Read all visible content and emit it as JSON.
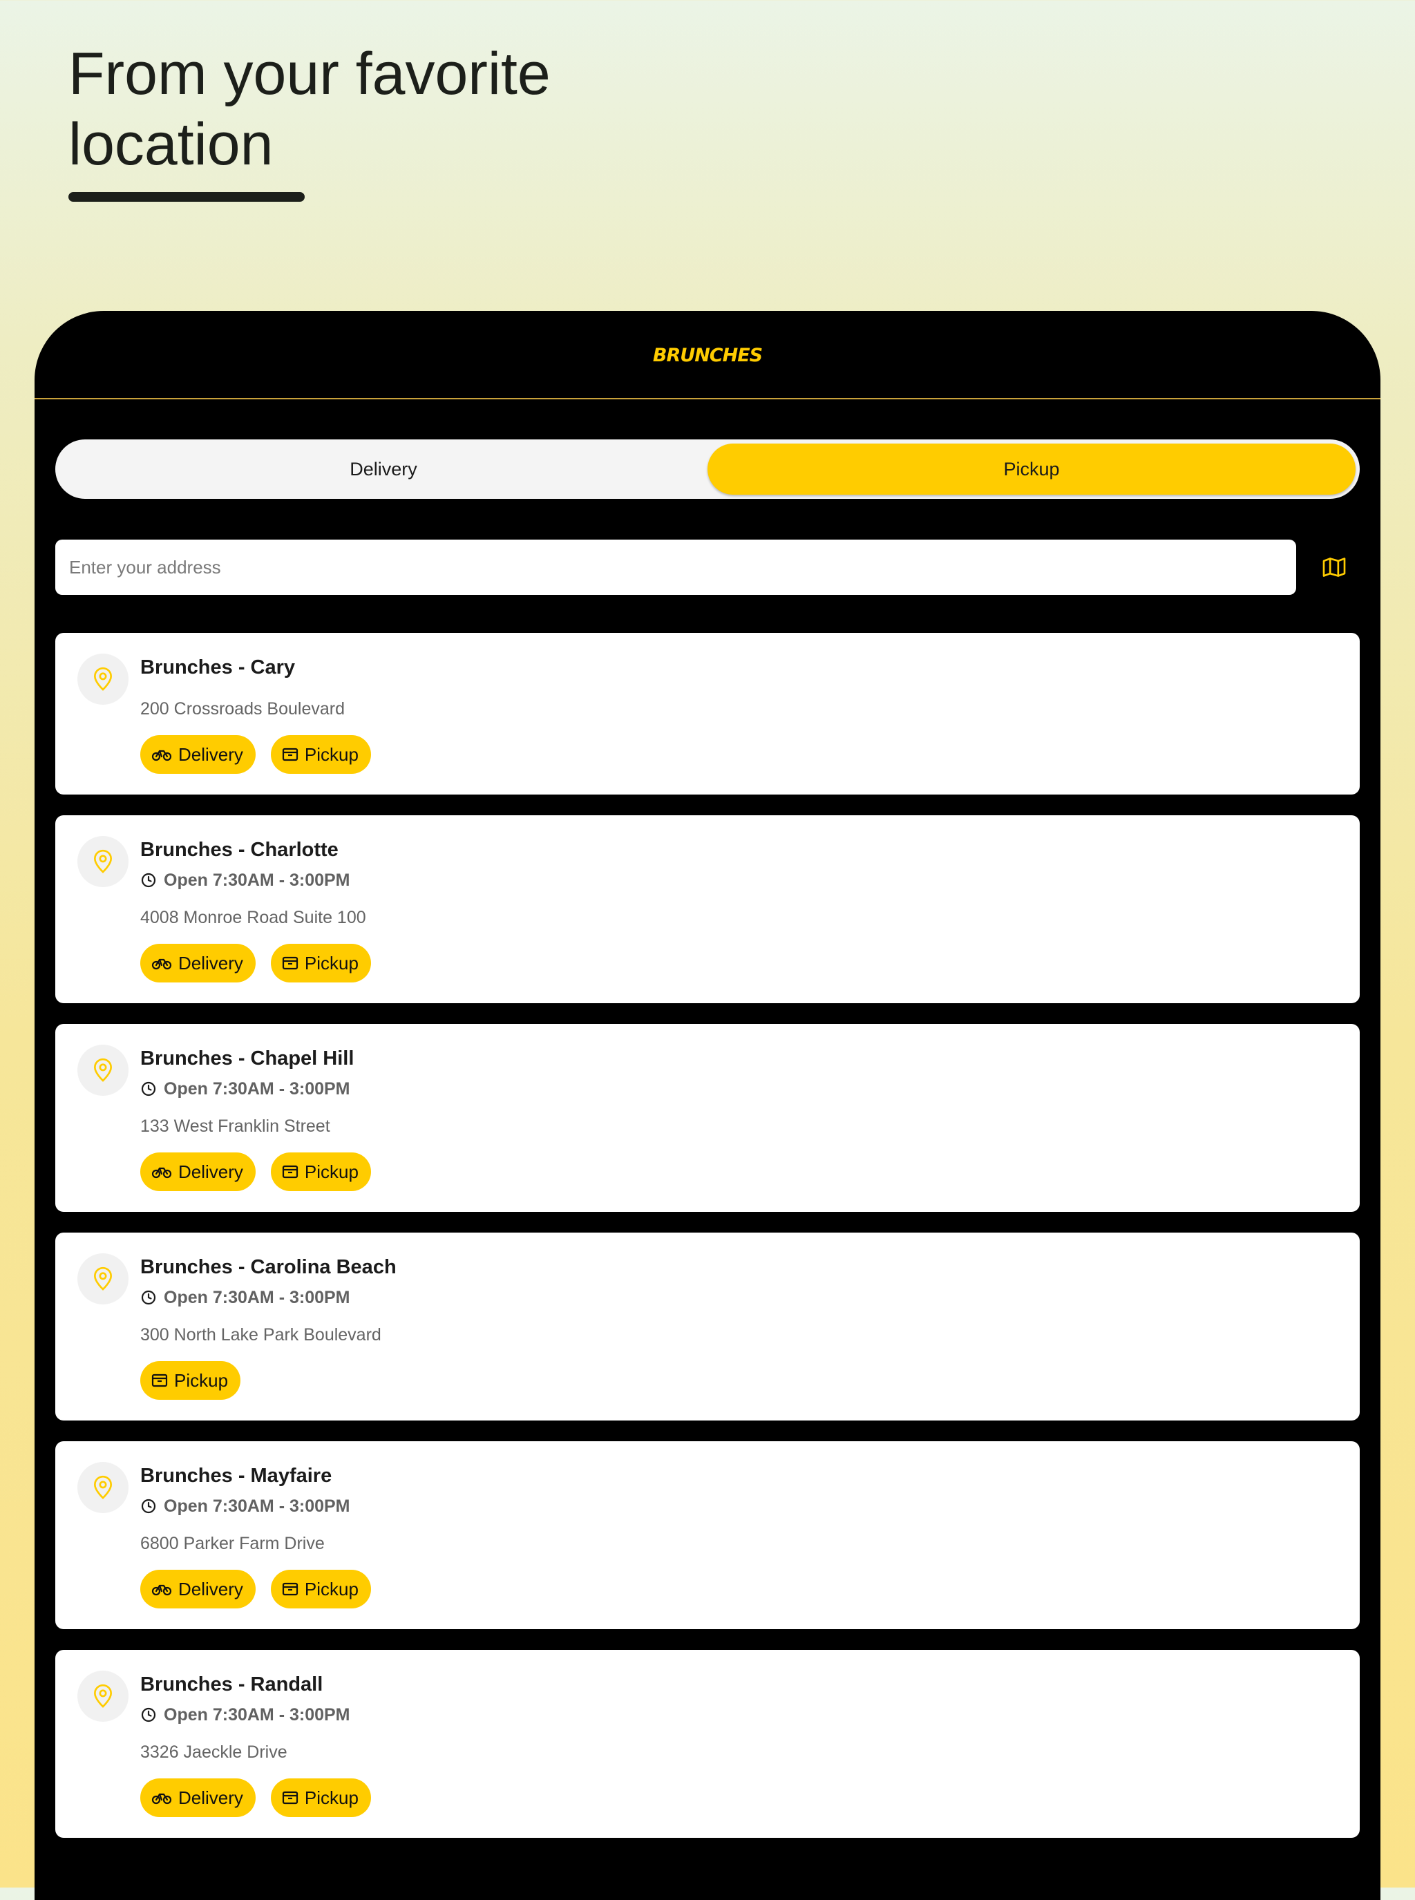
{
  "headline": {
    "line1": "From your favorite",
    "line2": "location"
  },
  "app": {
    "logo_text": "BRUNCHES",
    "colors": {
      "accent": "#ffcc00",
      "background": "#000000",
      "card": "#ffffff"
    }
  },
  "mode_toggle": {
    "delivery_label": "Delivery",
    "pickup_label": "Pickup",
    "selected": "Pickup"
  },
  "search": {
    "placeholder": "Enter your address",
    "value": "",
    "map_icon": "map-icon"
  },
  "locations": [
    {
      "name": "Brunches - Cary",
      "hours": "",
      "address": "200 Crossroads Boulevard",
      "delivery": "Delivery",
      "pickup": "Pickup"
    },
    {
      "name": "Brunches - Charlotte",
      "hours": "Open 7:30AM - 3:00PM",
      "address": "4008 Monroe Road Suite 100",
      "delivery": "Delivery",
      "pickup": "Pickup"
    },
    {
      "name": "Brunches - Chapel Hill",
      "hours": "Open 7:30AM - 3:00PM",
      "address": "133 West Franklin Street",
      "delivery": "Delivery",
      "pickup": "Pickup"
    },
    {
      "name": "Brunches - Carolina Beach",
      "hours": "Open 7:30AM - 3:00PM",
      "address": "300 North Lake Park Boulevard",
      "delivery": "",
      "pickup": "Pickup"
    },
    {
      "name": "Brunches - Mayfaire",
      "hours": "Open 7:30AM - 3:00PM",
      "address": "6800 Parker Farm Drive",
      "delivery": "Delivery",
      "pickup": "Pickup"
    },
    {
      "name": "Brunches - Randall",
      "hours": "Open 7:30AM - 3:00PM",
      "address": "3326 Jaeckle Drive",
      "delivery": "Delivery",
      "pickup": "Pickup"
    }
  ]
}
